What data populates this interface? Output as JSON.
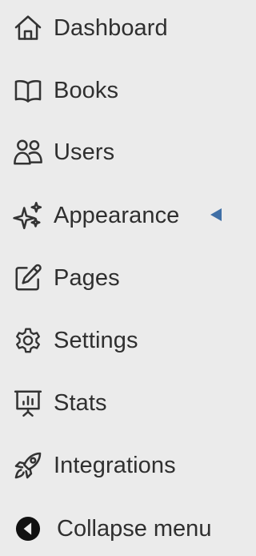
{
  "sidebar": {
    "items": [
      {
        "label": "Dashboard",
        "icon": "home-icon"
      },
      {
        "label": "Books",
        "icon": "book-open-icon"
      },
      {
        "label": "Users",
        "icon": "users-icon"
      },
      {
        "label": "Appearance",
        "icon": "sparkles-icon"
      },
      {
        "label": "Pages",
        "icon": "edit-page-icon"
      },
      {
        "label": "Settings",
        "icon": "gear-icon"
      },
      {
        "label": "Stats",
        "icon": "presentation-chart-icon"
      },
      {
        "label": "Integrations",
        "icon": "rocket-icon"
      }
    ],
    "collapse": {
      "label": "Collapse menu",
      "icon": "arrow-left-circle-icon"
    }
  },
  "colors": {
    "background": "#ebebeb",
    "text": "#2f2f2f",
    "icon": "#333333",
    "collapse_icon": "#111111",
    "pointer": "#3f6fa6"
  }
}
